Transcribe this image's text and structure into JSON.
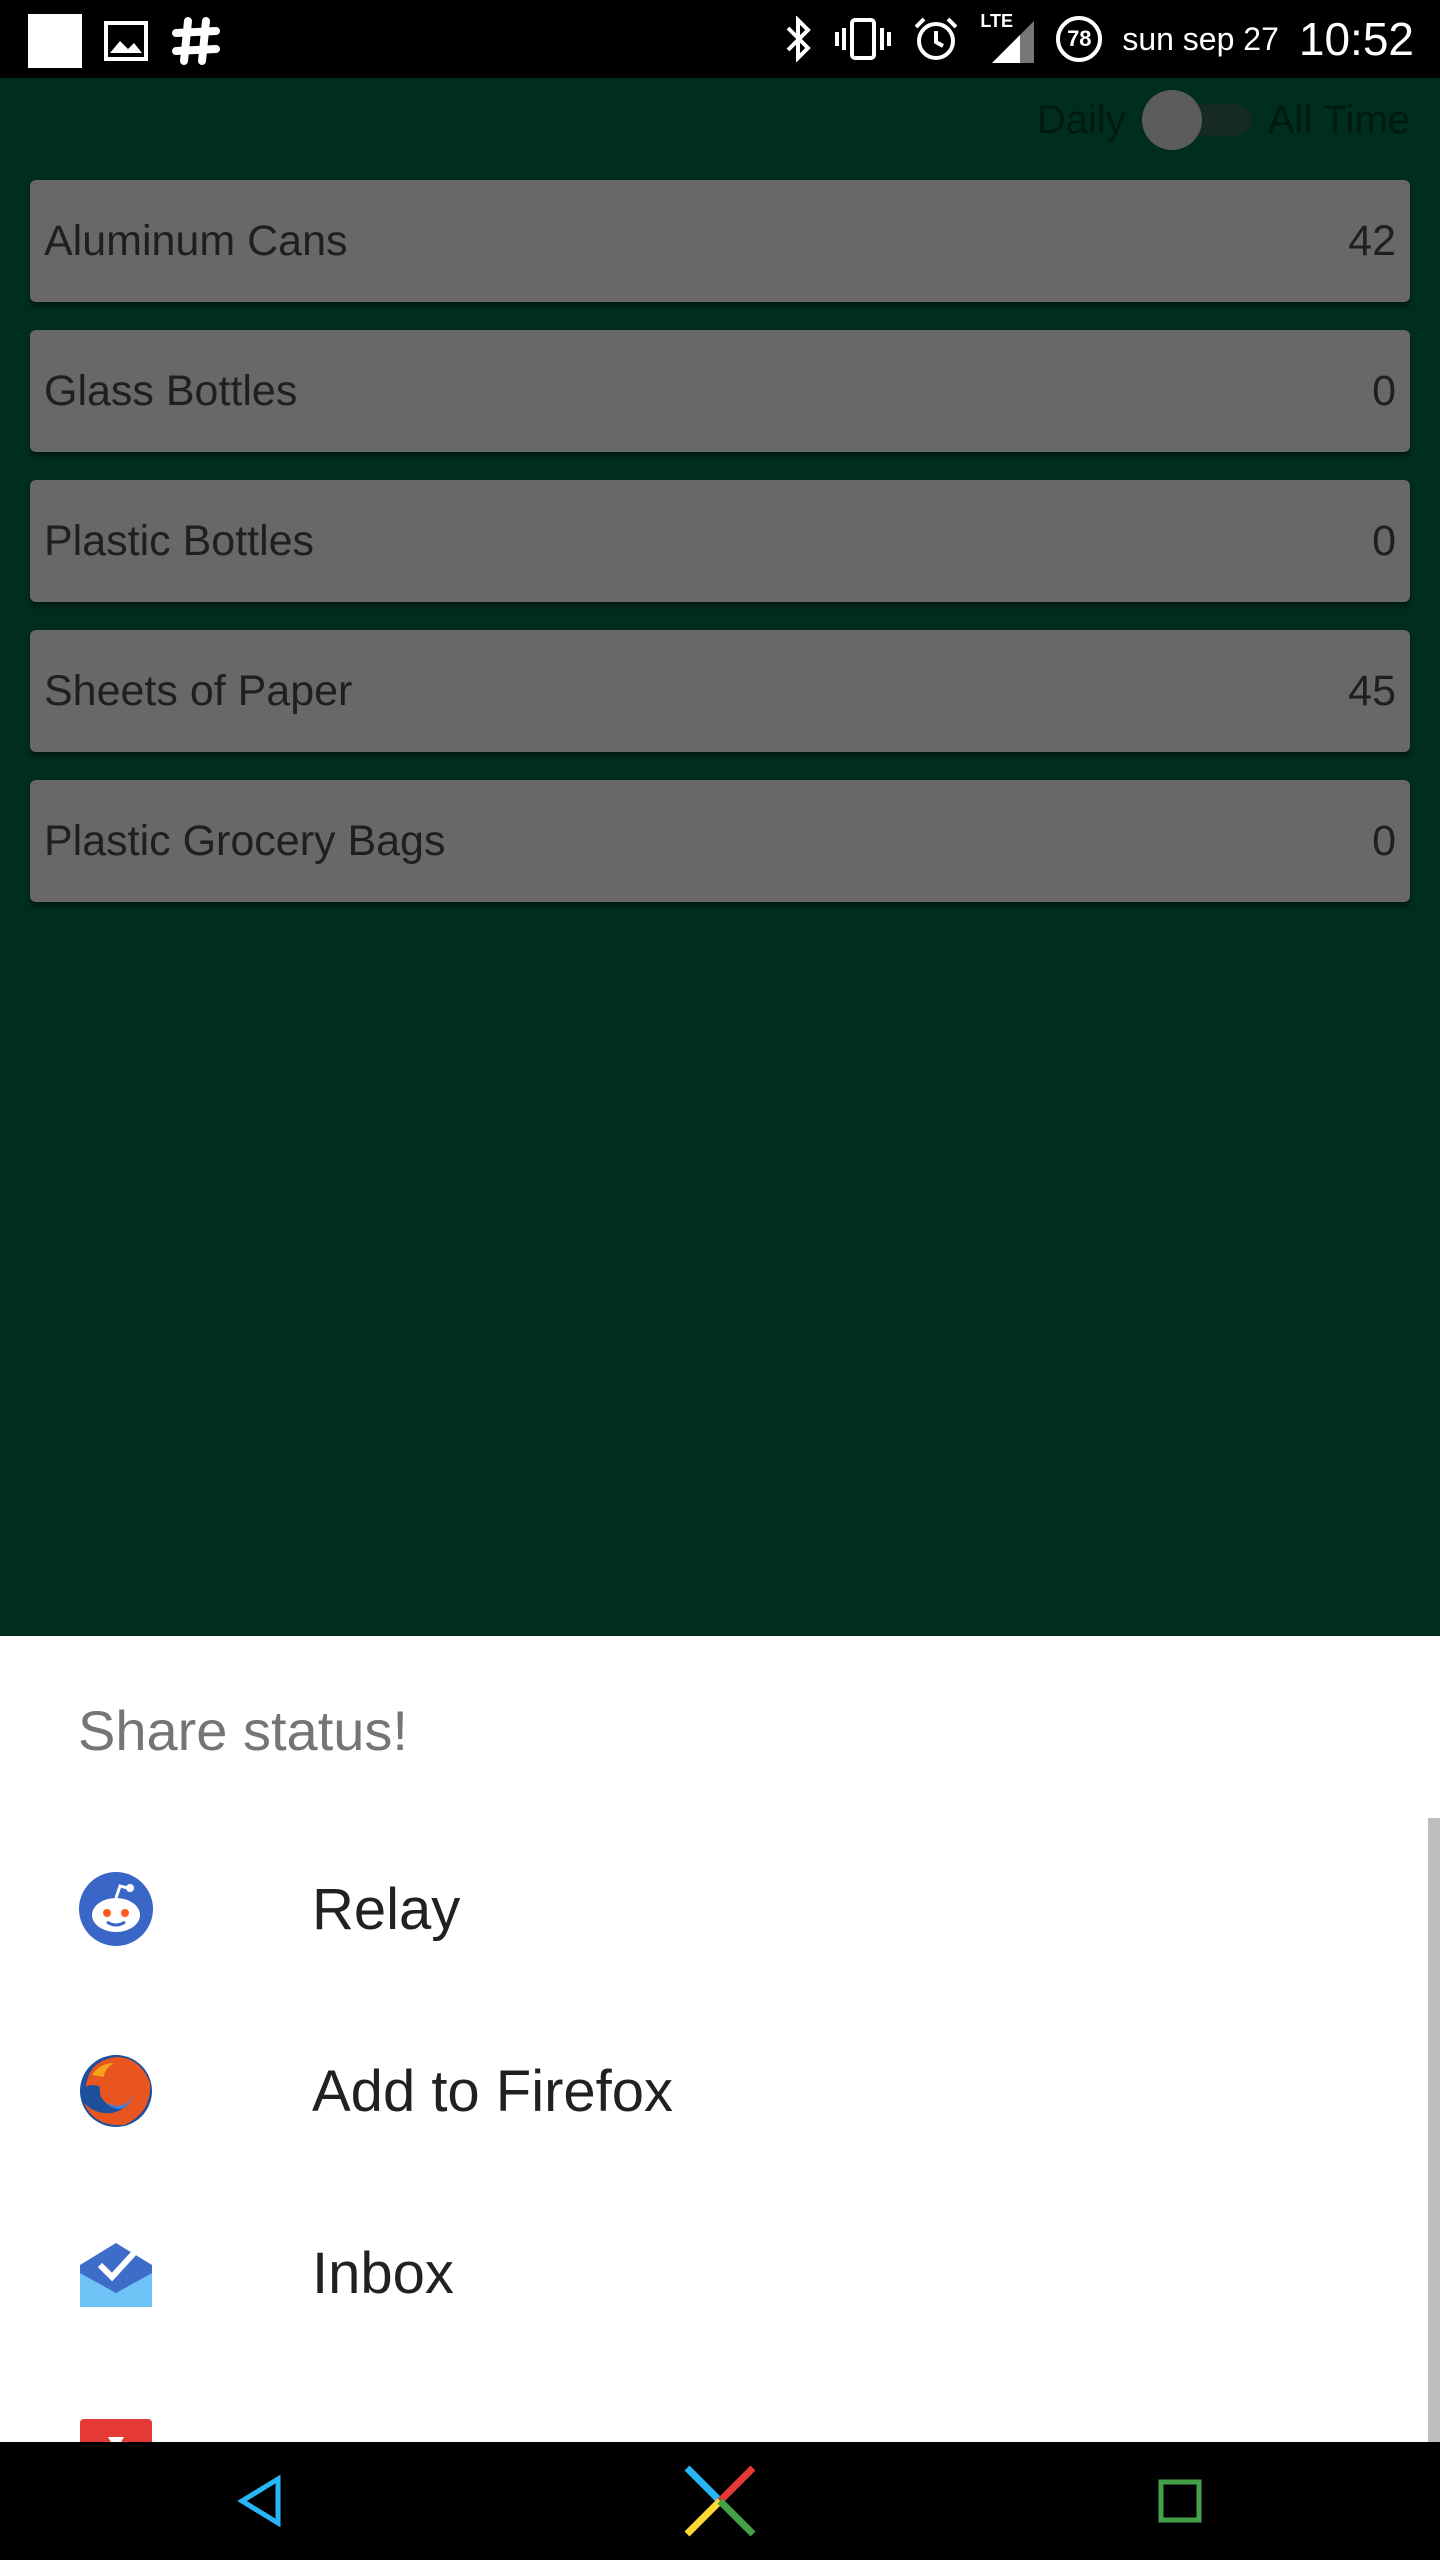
{
  "status_bar": {
    "date": "sun sep 27",
    "time": "10:52",
    "battery": "78",
    "signal_label": "LTE"
  },
  "toggle": {
    "left_label": "Daily",
    "right_label": "All Time",
    "state": "off"
  },
  "items": [
    {
      "name": "Aluminum Cans",
      "count": "42"
    },
    {
      "name": "Glass Bottles",
      "count": "0"
    },
    {
      "name": "Plastic Bottles",
      "count": "0"
    },
    {
      "name": "Sheets of Paper",
      "count": "45"
    },
    {
      "name": "Plastic Grocery Bags",
      "count": "0"
    }
  ],
  "share_sheet": {
    "title": "Share status!",
    "apps": [
      {
        "label": "Relay",
        "icon": "relay-icon"
      },
      {
        "label": "Add to Firefox",
        "icon": "firefox-icon"
      },
      {
        "label": "Inbox",
        "icon": "inbox-icon"
      }
    ]
  },
  "colors": {
    "background": "#002e1d",
    "item_bg": "#686868",
    "sheet_bg": "#ffffff"
  }
}
